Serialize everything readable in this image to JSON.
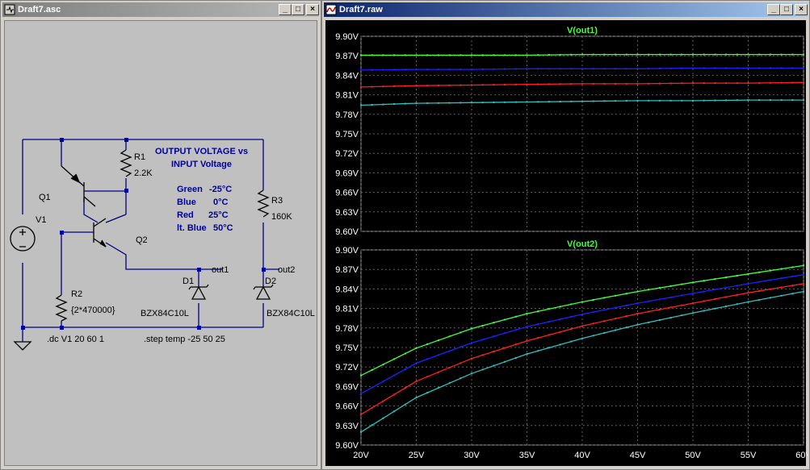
{
  "schematic_window": {
    "title": "Draft7.asc",
    "components": {
      "q1": "Q1",
      "q2": "Q2",
      "v1": "V1",
      "r1": "R1",
      "r1_value": "2.2K",
      "r2": "R2",
      "r2_value": "{2*470000}",
      "r3": "R3",
      "r3_value": "160K",
      "d1": "D1",
      "d1_value": "BZX84C10L",
      "d2": "D2",
      "d2_value": "BZX84C10L",
      "net_out1": "out1",
      "net_out2": "out2"
    },
    "comment": {
      "line1": "OUTPUT VOLTAGE vs",
      "line2": "INPUT Voltage",
      "legend": [
        {
          "name": "Green",
          "temp": "-25°C"
        },
        {
          "name": "Blue",
          "temp": "0°C"
        },
        {
          "name": "Red",
          "temp": "25°C"
        },
        {
          "name": "lt. Blue",
          "temp": "50°C"
        }
      ]
    },
    "directives": {
      "dc": ".dc V1 20 60 1",
      "step": ".step temp -25 50 25"
    }
  },
  "plot_window": {
    "title": "Draft7.raw",
    "buttons": {
      "minimize": "_",
      "maximize": "□",
      "close": "×"
    }
  },
  "colors": {
    "green": "#40ff40",
    "blue": "#2020ff",
    "red": "#ff2020",
    "ltblue": "#30c0c0",
    "grid": "#606060",
    "label": "#40ff40",
    "schematic_text": "#0000a0"
  },
  "chart_data": [
    {
      "type": "line",
      "title": "V(out1)",
      "x": [
        20,
        25,
        30,
        35,
        40,
        45,
        50,
        55,
        60
      ],
      "ylim": [
        9.6,
        9.9
      ],
      "yticks": [
        "9.90V",
        "9.87V",
        "9.84V",
        "9.81V",
        "9.78V",
        "9.75V",
        "9.72V",
        "9.69V",
        "9.66V",
        "9.63V",
        "9.60V"
      ],
      "series": [
        {
          "color": "#40ff40",
          "values": [
            9.871,
            9.871,
            9.871,
            9.871,
            9.872,
            9.872,
            9.872,
            9.872,
            9.872
          ]
        },
        {
          "color": "#2020ff",
          "values": [
            9.848,
            9.849,
            9.849,
            9.85,
            9.85,
            9.85,
            9.851,
            9.851,
            9.851
          ]
        },
        {
          "color": "#ff2020",
          "values": [
            9.822,
            9.824,
            9.825,
            9.826,
            9.827,
            9.827,
            9.828,
            9.828,
            9.829
          ]
        },
        {
          "color": "#30c0c0",
          "values": [
            9.794,
            9.797,
            9.798,
            9.799,
            9.8,
            9.801,
            9.801,
            9.802,
            9.802
          ]
        }
      ]
    },
    {
      "type": "line",
      "title": "V(out2)",
      "x": [
        20,
        25,
        30,
        35,
        40,
        45,
        50,
        55,
        60
      ],
      "xticks": [
        "20V",
        "25V",
        "30V",
        "35V",
        "40V",
        "45V",
        "50V",
        "55V",
        "60V"
      ],
      "ylim": [
        9.6,
        9.9
      ],
      "yticks": [
        "9.90V",
        "9.87V",
        "9.84V",
        "9.81V",
        "9.78V",
        "9.75V",
        "9.72V",
        "9.69V",
        "9.66V",
        "9.63V",
        "9.60V"
      ],
      "series": [
        {
          "color": "#40ff40",
          "values": [
            9.707,
            9.749,
            9.779,
            9.802,
            9.82,
            9.836,
            9.85,
            9.863,
            9.876
          ]
        },
        {
          "color": "#2020ff",
          "values": [
            9.679,
            9.726,
            9.757,
            9.782,
            9.801,
            9.818,
            9.833,
            9.848,
            9.862
          ]
        },
        {
          "color": "#ff2020",
          "values": [
            9.647,
            9.698,
            9.733,
            9.76,
            9.783,
            9.802,
            9.818,
            9.834,
            9.848
          ]
        },
        {
          "color": "#30c0c0",
          "values": [
            9.62,
            9.673,
            9.71,
            9.74,
            9.764,
            9.785,
            9.803,
            9.82,
            9.836
          ]
        }
      ]
    }
  ]
}
